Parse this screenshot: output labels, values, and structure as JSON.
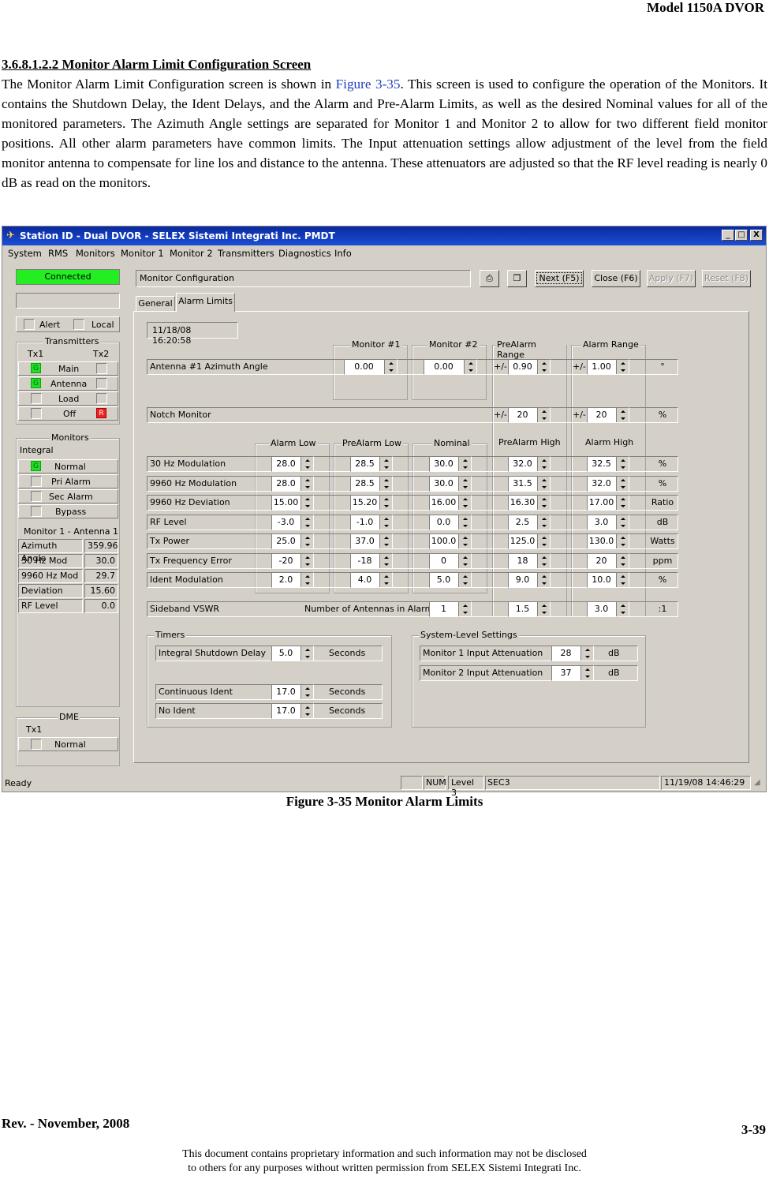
{
  "header": {
    "model": "Model 1150A DVOR"
  },
  "section": {
    "number": "3.6.8.1.2.2",
    "title": "Monitor Alarm Limit Configuration Screen",
    "para_before_ref": "The Monitor Alarm Limit Configuration screen is shown in ",
    "fig_ref": "Figure 3-35",
    "para_after_ref": ".  This screen is used to configure the operation of the Monitors. It contains the Shutdown Delay, the Ident Delays, and the Alarm and Pre-Alarm Limits, as well as the desired Nominal values for all of the monitored parameters.  The Azimuth Angle settings are separated for Monitor 1 and Monitor 2 to allow for two different field monitor positions. All other alarm parameters have common limits. The Input attenuation settings allow adjustment of the level from the field monitor antenna to compensate for line los and distance to the antenna. These attenuators are adjusted so that the RF level reading is nearly 0 dB as read on the monitors."
  },
  "window": {
    "title": "Station ID - Dual DVOR - SELEX Sistemi Integrati Inc. PMDT",
    "controls": [
      "_",
      "□",
      "X"
    ],
    "menu": [
      "System",
      "RMS",
      "Monitors",
      "Monitor 1",
      "Monitor 2",
      "Transmitters",
      "Diagnostics",
      "Info"
    ],
    "status_connected": "Connected",
    "config_title": "Monitor Configuration",
    "toolbar": {
      "next": "Next (F5)",
      "close": "Close (F6)",
      "apply": "Apply (F7)",
      "reset": "Reset (F8)"
    },
    "tabs": [
      "General",
      "Alarm Limits"
    ],
    "timestamp": "11/18/08 16:20:58",
    "left": {
      "alert": "Alert",
      "local": "Local",
      "transmitters": {
        "title": "Transmitters",
        "tx1": "Tx1",
        "tx2": "Tx2",
        "rows": [
          "Main",
          "Antenna",
          "Load",
          "Off"
        ],
        "g": "G",
        "r": "R"
      },
      "monitors": {
        "title": "Monitors",
        "integral": "Integral",
        "g": "G",
        "rows": [
          "Normal",
          "Pri Alarm",
          "Sec Alarm",
          "Bypass"
        ],
        "mon_title": "Monitor 1 - Antenna 1",
        "readings": [
          {
            "label": "Azimuth Angle",
            "value": "359.96"
          },
          {
            "label": "30 Hz Mod",
            "value": "30.0"
          },
          {
            "label": "9960 Hz Mod",
            "value": "29.7"
          },
          {
            "label": "Deviation",
            "value": "15.60"
          },
          {
            "label": "RF Level",
            "value": "0.0"
          }
        ]
      },
      "dme": {
        "title": "DME",
        "tx1": "Tx1",
        "row": "Normal"
      }
    },
    "grid": {
      "az_headers": [
        "Monitor #1",
        "Monitor #2",
        "PreAlarm Range",
        "Alarm Range"
      ],
      "az_row": {
        "label": "Antenna #1 Azimuth Angle",
        "m1": "0.00",
        "m2": "0.00",
        "pm1": "+/-",
        "pre": "0.90",
        "pm2": "+/-",
        "alarm": "1.00",
        "unit": "°"
      },
      "notch_row": {
        "label": "Notch Monitor",
        "pm1": "+/-",
        "pre": "20",
        "pm2": "+/-",
        "alarm": "20",
        "unit": "%"
      },
      "headers": [
        "Alarm Low",
        "PreAlarm Low",
        "Nominal",
        "PreAlarm High",
        "Alarm High"
      ],
      "rows": [
        {
          "label": "30 Hz Modulation",
          "v": [
            "28.0",
            "28.5",
            "30.0",
            "32.0",
            "32.5"
          ],
          "unit": "%"
        },
        {
          "label": "9960 Hz Modulation",
          "v": [
            "28.0",
            "28.5",
            "30.0",
            "31.5",
            "32.0"
          ],
          "unit": "%"
        },
        {
          "label": "9960 Hz Deviation",
          "v": [
            "15.00",
            "15.20",
            "16.00",
            "16.30",
            "17.00"
          ],
          "unit": "Ratio"
        },
        {
          "label": "RF Level",
          "v": [
            "-3.0",
            "-1.0",
            "0.0",
            "2.5",
            "3.0"
          ],
          "unit": "dB"
        },
        {
          "label": "Tx Power",
          "v": [
            "25.0",
            "37.0",
            "100.0",
            "125.0",
            "130.0"
          ],
          "unit": "Watts"
        },
        {
          "label": "Tx Frequency Error",
          "v": [
            "-20",
            "-18",
            "0",
            "18",
            "20"
          ],
          "unit": "ppm"
        },
        {
          "label": "Ident Modulation",
          "v": [
            "2.0",
            "4.0",
            "5.0",
            "9.0",
            "10.0"
          ],
          "unit": "%"
        }
      ],
      "vswr_row": {
        "label": "Sideband VSWR",
        "ant_label": "Number of Antennas in Alarm",
        "ant": "1",
        "pre": "1.5",
        "alarm": "3.0",
        "unit": ":1"
      }
    },
    "timers": {
      "title": "Timers",
      "rows": [
        {
          "label": "Integral Shutdown Delay",
          "value": "5.0",
          "unit": "Seconds"
        },
        {
          "label": "Continuous Ident",
          "value": "17.0",
          "unit": "Seconds"
        },
        {
          "label": "No Ident",
          "value": "17.0",
          "unit": "Seconds"
        }
      ]
    },
    "system": {
      "title": "System-Level Settings",
      "rows": [
        {
          "label": "Monitor 1 Input Attenuation",
          "value": "28",
          "unit": "dB"
        },
        {
          "label": "Monitor 2 Input Attenuation",
          "value": "37",
          "unit": "dB"
        }
      ]
    },
    "statusbar": {
      "ready": "Ready",
      "num": "NUM",
      "level": "Level 3",
      "sec": "SEC3",
      "time": "11/19/08 14:46:29"
    }
  },
  "caption": "Figure 3-35  Monitor Alarm Limits",
  "footer": {
    "rev": "Rev. -  November, 2008",
    "page": "3-39",
    "disclaimer1": "This document contains proprietary information and such information may not be disclosed",
    "disclaimer2": "to others for any purposes without written permission from SELEX Sistemi Integrati Inc."
  }
}
